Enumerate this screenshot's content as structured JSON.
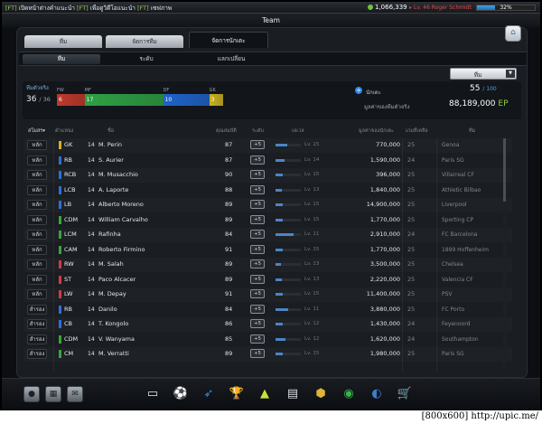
{
  "topbar": {
    "ticker_tag1": "[FT]",
    "ticker_msg1": "เปิดหน้าต่างคำแนะนำ",
    "ticker_tag2": "[FT]",
    "ticker_msg2": "เพื่อดูวิดีโอแนะนำ",
    "ticker_tag3": "[FT]",
    "ticker_msg3": "เซฟภาพ",
    "currency_value": "1,066,339",
    "user_level": "Lv. 46 Roger Schmidt",
    "progress_text": "32%",
    "progress_percent": 32
  },
  "window_title": "Team",
  "tabs": {
    "team": "ทีม",
    "manage": "จัดการทีม",
    "players": "จัดการนักเตะ"
  },
  "subtabs": {
    "team": "ทีม",
    "level": "ระดับ",
    "exchange": "แลกเปลี่ยน"
  },
  "dropdown": {
    "selected": "ทีม"
  },
  "summary": {
    "lineup_label": "ทีมตัวจริง",
    "lineup_count": "36",
    "lineup_max": "/ 36",
    "formation": [
      {
        "label": "FW",
        "count": "6",
        "color": "#c0392b"
      },
      {
        "label": "MF",
        "count": "17",
        "color": "#2ea043"
      },
      {
        "label": "DF",
        "count": "10",
        "color": "#1f63c9"
      },
      {
        "label": "GK",
        "count": "3",
        "color": "#c9b21f"
      }
    ],
    "add_label": "นักเตะ",
    "slot_count": "55",
    "slot_max": "/ 100",
    "value_label": "มูลค่าของทีมตัวจริง",
    "value_amount": "88,189,000",
    "value_unit": "EP"
  },
  "table_headers": {
    "status": "สโมสร▾",
    "position": "ตำแหน่ง",
    "name": "ชื่อ",
    "ovr": "คุณสมบัติ",
    "level": "ระดับ",
    "exp": "เลเวล",
    "price": "มูลค่าของนักเตะ",
    "contract": "เกมที่เหลือ",
    "club": "ทีม"
  },
  "level_button": "+5",
  "players": [
    {
      "status": "หลัก",
      "pos": "GK",
      "pos_color": "#d6b21c",
      "name": "M. Perin",
      "ovr": "87",
      "level": "Lv. 15",
      "exp": 0.45,
      "price": "770,000",
      "contract": "25",
      "club": "Genoa"
    },
    {
      "status": "หลัก",
      "pos": "RB",
      "pos_color": "#2f6fd6",
      "name": "S. Aurier",
      "ovr": "87",
      "level": "Lv. 14",
      "exp": 0.35,
      "price": "1,590,000",
      "contract": "24",
      "club": "Paris SG"
    },
    {
      "status": "หลัก",
      "pos": "RCB",
      "pos_color": "#2f6fd6",
      "name": "M. Musacchio",
      "ovr": "90",
      "level": "Lv. 15",
      "exp": 0.3,
      "price": "396,000",
      "contract": "25",
      "club": "Villarreal CF"
    },
    {
      "status": "หลัก",
      "pos": "LCB",
      "pos_color": "#2f6fd6",
      "name": "A. Laporte",
      "ovr": "88",
      "level": "Lv. 13",
      "exp": 0.25,
      "price": "1,840,000",
      "contract": "25",
      "club": "Athletic Bilbao"
    },
    {
      "status": "หลัก",
      "pos": "LB",
      "pos_color": "#2f6fd6",
      "name": "Alberto Moreno",
      "ovr": "89",
      "level": "Lv. 15",
      "exp": 0.3,
      "price": "14,900,000",
      "contract": "25",
      "club": "Liverpool"
    },
    {
      "status": "หลัก",
      "pos": "CDM",
      "pos_color": "#3aa53a",
      "name": "William Carvalho",
      "ovr": "89",
      "level": "Lv. 15",
      "exp": 0.3,
      "price": "1,770,000",
      "contract": "25",
      "club": "Sporting CP"
    },
    {
      "status": "หลัก",
      "pos": "LCM",
      "pos_color": "#3aa53a",
      "name": "Rafinha",
      "ovr": "84",
      "level": "Lv. 11",
      "exp": 0.7,
      "price": "2,910,000",
      "contract": "24",
      "club": "FC Barcelona"
    },
    {
      "status": "หลัก",
      "pos": "CAM",
      "pos_color": "#3aa53a",
      "name": "Roberto Firmino",
      "ovr": "91",
      "level": "Lv. 15",
      "exp": 0.3,
      "price": "1,770,000",
      "contract": "25",
      "club": "1899 Hoffenheim"
    },
    {
      "status": "หลัก",
      "pos": "RW",
      "pos_color": "#d63a3a",
      "name": "M. Salah",
      "ovr": "89",
      "level": "Lv. 13",
      "exp": 0.2,
      "price": "3,500,000",
      "contract": "25",
      "club": "Chelsea"
    },
    {
      "status": "หลัก",
      "pos": "ST",
      "pos_color": "#d63a3a",
      "name": "Paco Alcacer",
      "ovr": "89",
      "level": "Lv. 13",
      "exp": 0.25,
      "price": "2,220,000",
      "contract": "25",
      "club": "Valencia CF"
    },
    {
      "status": "หลัก",
      "pos": "LW",
      "pos_color": "#d63a3a",
      "name": "M. Depay",
      "ovr": "91",
      "level": "Lv. 15",
      "exp": 0.3,
      "price": "11,400,000",
      "contract": "25",
      "club": "PSV"
    },
    {
      "status": "สำรอง",
      "pos": "RB",
      "pos_color": "#2f6fd6",
      "name": "Danilo",
      "ovr": "84",
      "level": "Lv. 11",
      "exp": 0.5,
      "price": "3,880,000",
      "contract": "25",
      "club": "FC Porto"
    },
    {
      "status": "สำรอง",
      "pos": "CB",
      "pos_color": "#2f6fd6",
      "name": "T. Kongolo",
      "ovr": "86",
      "level": "Lv. 12",
      "exp": 0.3,
      "price": "1,430,000",
      "contract": "24",
      "club": "Feyenoord"
    },
    {
      "status": "สำรอง",
      "pos": "CDM",
      "pos_color": "#3aa53a",
      "name": "V. Wanyama",
      "ovr": "85",
      "level": "Lv. 12",
      "exp": 0.4,
      "price": "1,620,000",
      "contract": "24",
      "club": "Southampton"
    },
    {
      "status": "สำรอง",
      "pos": "CM",
      "pos_color": "#3aa53a",
      "name": "M. Verratti",
      "ovr": "89",
      "level": "Lv. 15",
      "exp": 0.3,
      "price": "1,980,000",
      "contract": "25",
      "club": "Paris SG"
    }
  ],
  "bottom_icons": [
    {
      "name": "cards-icon",
      "glyph": "▭",
      "color": "#e8e8e8"
    },
    {
      "name": "ball-icon",
      "glyph": "⚽",
      "color": "#ffffff"
    },
    {
      "name": "boot-icon",
      "glyph": "➶",
      "color": "#3a8de0"
    },
    {
      "name": "trophy-icon",
      "glyph": "🏆",
      "color": "#c0c4c8"
    },
    {
      "name": "cone-icon",
      "glyph": "▲",
      "color": "#c6e23a"
    },
    {
      "name": "book-icon",
      "glyph": "▤",
      "color": "#d8dde2"
    },
    {
      "name": "medal-icon",
      "glyph": "⬢",
      "color": "#e0b43a"
    },
    {
      "name": "pitch-icon",
      "glyph": "◉",
      "color": "#3ab34a"
    },
    {
      "name": "scout-icon",
      "glyph": "◐",
      "color": "#3a7fd6"
    },
    {
      "name": "shop-icon",
      "glyph": "🛒",
      "color": "#5aa0e6"
    }
  ],
  "caption": "[800x600] http://upic.me/"
}
